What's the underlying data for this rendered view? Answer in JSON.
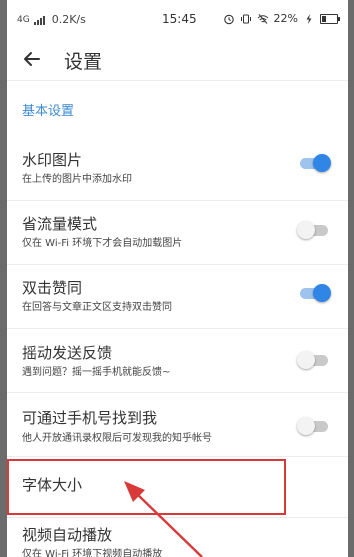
{
  "status_bar": {
    "network": "4G",
    "speed": "0.2K/s",
    "time": "15:45",
    "battery": "22%"
  },
  "app_bar": {
    "title": "设置"
  },
  "section": {
    "title": "基本设置"
  },
  "settings": [
    {
      "title": "水印图片",
      "subtitle": "在上传的图片中添加水印",
      "toggle": "on"
    },
    {
      "title": "省流量模式",
      "subtitle": "仅在 Wi-Fi 环境下才会自动加载图片",
      "toggle": "off"
    },
    {
      "title": "双击赞同",
      "subtitle": "在回答与文章正文区支持双击赞同",
      "toggle": "on"
    },
    {
      "title": "摇动发送反馈",
      "subtitle": "遇到问题？摇一摇手机就能反馈~",
      "toggle": "off"
    },
    {
      "title": "可通过手机号找到我",
      "subtitle": "他人开放通讯录权限后可发现我的知乎帐号",
      "toggle": "off"
    },
    {
      "title": "字体大小",
      "subtitle": "",
      "toggle": "none"
    },
    {
      "title": "视频自动播放",
      "subtitle": "仅在 Wi-Fi 环境下视频自动播放",
      "toggle": "none"
    }
  ],
  "colors": {
    "accent": "#2f86e6",
    "section_header": "#3d8bd0",
    "annotation": "#d83a3a"
  }
}
